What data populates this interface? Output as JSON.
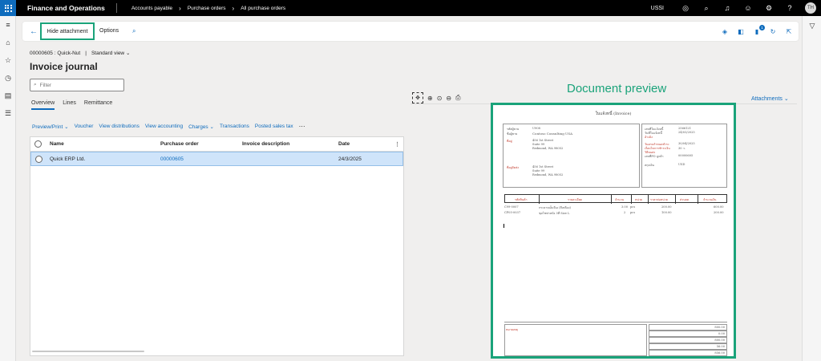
{
  "app": {
    "title": "Finance and Operations",
    "breadcrumbs": [
      "Accounts payable",
      "Purchase orders",
      "All purchase orders"
    ],
    "company": "USSI",
    "user_initials": "TH"
  },
  "action_pane": {
    "hide_attachment": "Hide attachment",
    "options": "Options",
    "notification_count": "1"
  },
  "header": {
    "record": "00000605 : Quick-Nut",
    "separator": "|",
    "view": "Standard view",
    "title": "Invoice journal",
    "filter_placeholder": "Filter"
  },
  "tabs": [
    "Overview",
    "Lines",
    "Remittance"
  ],
  "toolbar": [
    "Preview/Print",
    "Voucher",
    "View distributions",
    "View accounting",
    "Charges",
    "Transactions",
    "Posted sales tax"
  ],
  "grid": {
    "columns": [
      "Name",
      "Purchase order",
      "Invoice description",
      "Date"
    ],
    "rows": [
      {
        "name": "Quick ERP Ltd.",
        "purchase_order": "00000605",
        "invoice_description": "",
        "date": "24/3/2025"
      }
    ]
  },
  "preview": {
    "title": "Document preview",
    "attachments": "Attachments",
    "doc": {
      "heading": "ใบแจ้งหนี้ (Invoice)",
      "vendor_account": "U908",
      "vendor_name": "Contoso Consulting USA",
      "address_1": "456 1st Street",
      "address_2": "Suite 99",
      "address_3": "Redmond, WA 98052",
      "invoice_no": "2566121",
      "invoice_date": "24/03/2025",
      "due_date": "30/04/2025",
      "terms": "30 ว.",
      "po_no": "00000605",
      "currency": "USD",
      "columns": [
        "รหัสสินค้า",
        "รายละเอียด",
        "จำนวน",
        "หน่วย",
        "ราคาต่อหน่วย",
        "ส่วนลด",
        "จำนวนเงิน"
      ],
      "lines": [
        {
          "code": "C99-0007",
          "desc": "กระดาษเอ็มจีเอ (สีเหลือง)",
          "qty": "3.00",
          "unit": "pcs",
          "price": "200.00",
          "amount": "600.00"
        },
        {
          "code": "CP05-0037",
          "desc": "ชุดโซฟาหนัง 3ที่ Size L",
          "qty": "2",
          "unit": "pcs",
          "price": "100.00",
          "amount": "200.00"
        }
      ],
      "remark_label": "หมายเหตุ",
      "totals": [
        "800.00",
        "0.00",
        "800.00",
        "56.00",
        "856.00"
      ]
    }
  },
  "colors": {
    "accent": "#0f6cbd",
    "highlight": "#1aa37a",
    "selected_row": "#cfe4fa"
  }
}
